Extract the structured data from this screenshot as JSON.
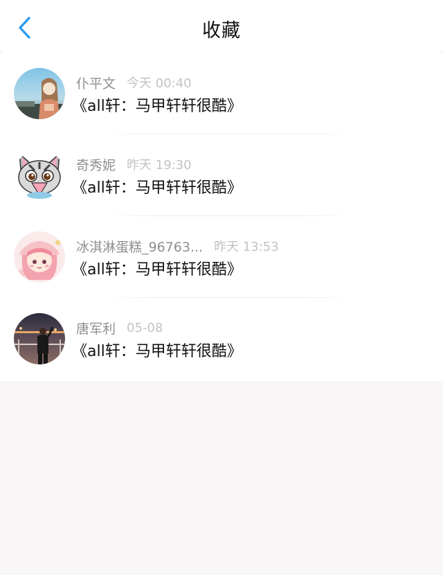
{
  "header": {
    "title": "收藏",
    "back_icon": "chevron-left-icon",
    "accent_color": "#2b9cf2"
  },
  "favorites": [
    {
      "name": "仆平文",
      "time": "今天 00:40",
      "content": "《all轩：马甲轩轩很酷》",
      "avatar_icon": "anime-girl-avatar"
    },
    {
      "name": "奇秀妮",
      "time": "昨天 19:30",
      "content": "《all轩：马甲轩轩很酷》",
      "avatar_icon": "cartoon-cat-avatar"
    },
    {
      "name": "冰淇淋蛋糕_96763...",
      "time": "昨天 13:53",
      "content": "《all轩：马甲轩轩很酷》",
      "avatar_icon": "pink-chibi-girl-avatar"
    },
    {
      "name": "唐军利",
      "time": "05-08",
      "content": "《all轩：马甲轩轩很酷》",
      "avatar_icon": "man-night-photo-avatar"
    }
  ]
}
